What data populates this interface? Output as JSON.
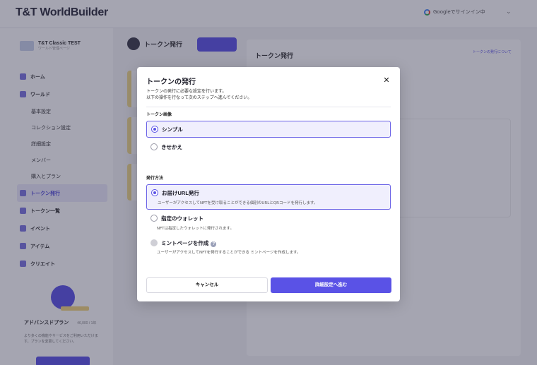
{
  "app": {
    "logo": "T&T WorldBuilder"
  },
  "topbar": {
    "google_label": "Googleでサインイン中"
  },
  "sidebar": {
    "workspace_name": "T&T Classic TEST",
    "workspace_sub": "ワールド管理ページ",
    "items": [
      {
        "label": "ホーム",
        "type": "main"
      },
      {
        "label": "ワールド",
        "type": "main"
      },
      {
        "label": "基本設定",
        "type": "sub"
      },
      {
        "label": "コレクション設定",
        "type": "sub"
      },
      {
        "label": "詳細設定",
        "type": "sub"
      },
      {
        "label": "メンバー",
        "type": "sub"
      },
      {
        "label": "購入とプラン",
        "type": "sub"
      },
      {
        "label": "トークン発行",
        "type": "main",
        "active": true
      },
      {
        "label": "トークン一覧",
        "type": "main"
      },
      {
        "label": "イベント",
        "type": "main"
      },
      {
        "label": "アイテム",
        "type": "main"
      },
      {
        "label": "クリエイト",
        "type": "main"
      }
    ],
    "advance": {
      "title": "アドバンスドプラン",
      "count": "46,000 / 1年",
      "text": "より多くの機能やサービスをご利用いただけます。プランを変更してください。"
    }
  },
  "main": {
    "page_title": "トークン発行",
    "panel_title": "トークン発行",
    "panel_link": "トークンの発行について"
  },
  "modal": {
    "title": "トークンの発行",
    "close_symbol": "✕",
    "desc_line1": "トークンの発行に必要な設定を行います。",
    "desc_line2": "以下の操作を行なって次のステップへ進んでください。",
    "image_section": {
      "label": "トークン画像",
      "options": [
        {
          "label": "シンプル",
          "selected": true
        },
        {
          "label": "きせかえ",
          "selected": false
        }
      ]
    },
    "method_section": {
      "label": "発行方法",
      "options": [
        {
          "label": "お届けURL発行",
          "desc": "ユーザーがアクセスしてNFTを受け取ることができる個別のURLとQRコードを発行します。",
          "selected": true
        },
        {
          "label": "指定のウォレット",
          "desc": "NFTは指定したウォレットに発行されます。",
          "selected": false
        },
        {
          "label": "ミントページを作成",
          "desc": "ユーザーがアクセスしてNFTを発行することができる ミントページを作成します。",
          "selected": false,
          "disabled": true,
          "help": "?"
        }
      ]
    },
    "cancel_label": "キャンセル",
    "next_label": "詳細設定へ進む"
  },
  "colors": {
    "accent": "#5a52e6",
    "selected_bg": "#f0effd"
  }
}
